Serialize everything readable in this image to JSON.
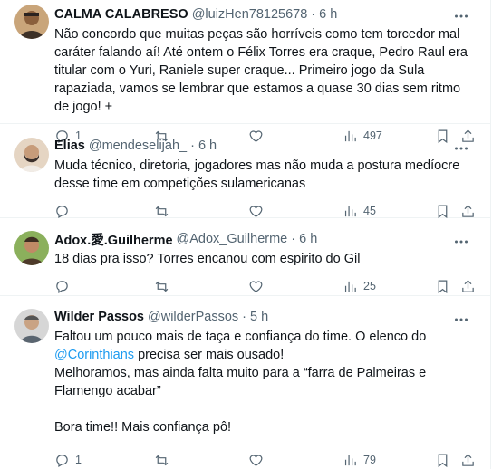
{
  "tweets": [
    {
      "name": "CALMA CALABRESO",
      "handle": "@luizHen78125678",
      "time": "6 h",
      "paragraphs": [
        "Não concordo que muitas peças são horríveis como tem torcedor mal caráter falando aí! Até ontem o Félix Torres era craque, Pedro Raul era titular com o Yuri, Raniele super craque... Primeiro jogo da Sula rapaziada, vamos se lembrar que estamos a quase 30 dias sem ritmo de jogo! +"
      ],
      "replies": "1",
      "retweets": "",
      "likes": "",
      "views": "497",
      "avatar_colors": [
        "#b98c5c",
        "#3d3026"
      ]
    },
    {
      "name": "Elias",
      "handle": "@mendeselijah_",
      "time": "6 h",
      "paragraphs": [
        "Muda técnico, diretoria, jogadores mas não muda a postura medíocre desse time em competições sulamericanas"
      ],
      "replies": "",
      "retweets": "",
      "likes": "",
      "views": "45",
      "avatar_colors": [
        "#d9c3ad",
        "#2f2a27"
      ]
    },
    {
      "name": "Adox.愛.Guilherme",
      "handle": "@Adox_Guilherme",
      "time": "6 h",
      "paragraphs": [
        "18 dias pra isso? Torres encanou com espirito do Gil"
      ],
      "replies": "",
      "retweets": "",
      "likes": "",
      "views": "25",
      "avatar_colors": [
        "#7fa24e",
        "#4e3a2a"
      ]
    },
    {
      "name": "Wilder Passos",
      "handle": "@wilderPassos",
      "time": "5 h",
      "paragraphs_html": true,
      "text_before": "Faltou um pouco mais de taça e confiança do time. O elenco do",
      "mention": "@Corinthians",
      "text_after": " precisa ser mais ousado!",
      "paragraph2": "Melhoramos, mas ainda falta muito para a “farra de Palmeiras e Flamengo acabar”",
      "paragraph3": "Bora time!! Mais confiança pô!",
      "replies": "1",
      "retweets": "",
      "likes": "",
      "views": "79",
      "avatar_colors": [
        "#c8c8c8",
        "#5a6570"
      ]
    }
  ]
}
